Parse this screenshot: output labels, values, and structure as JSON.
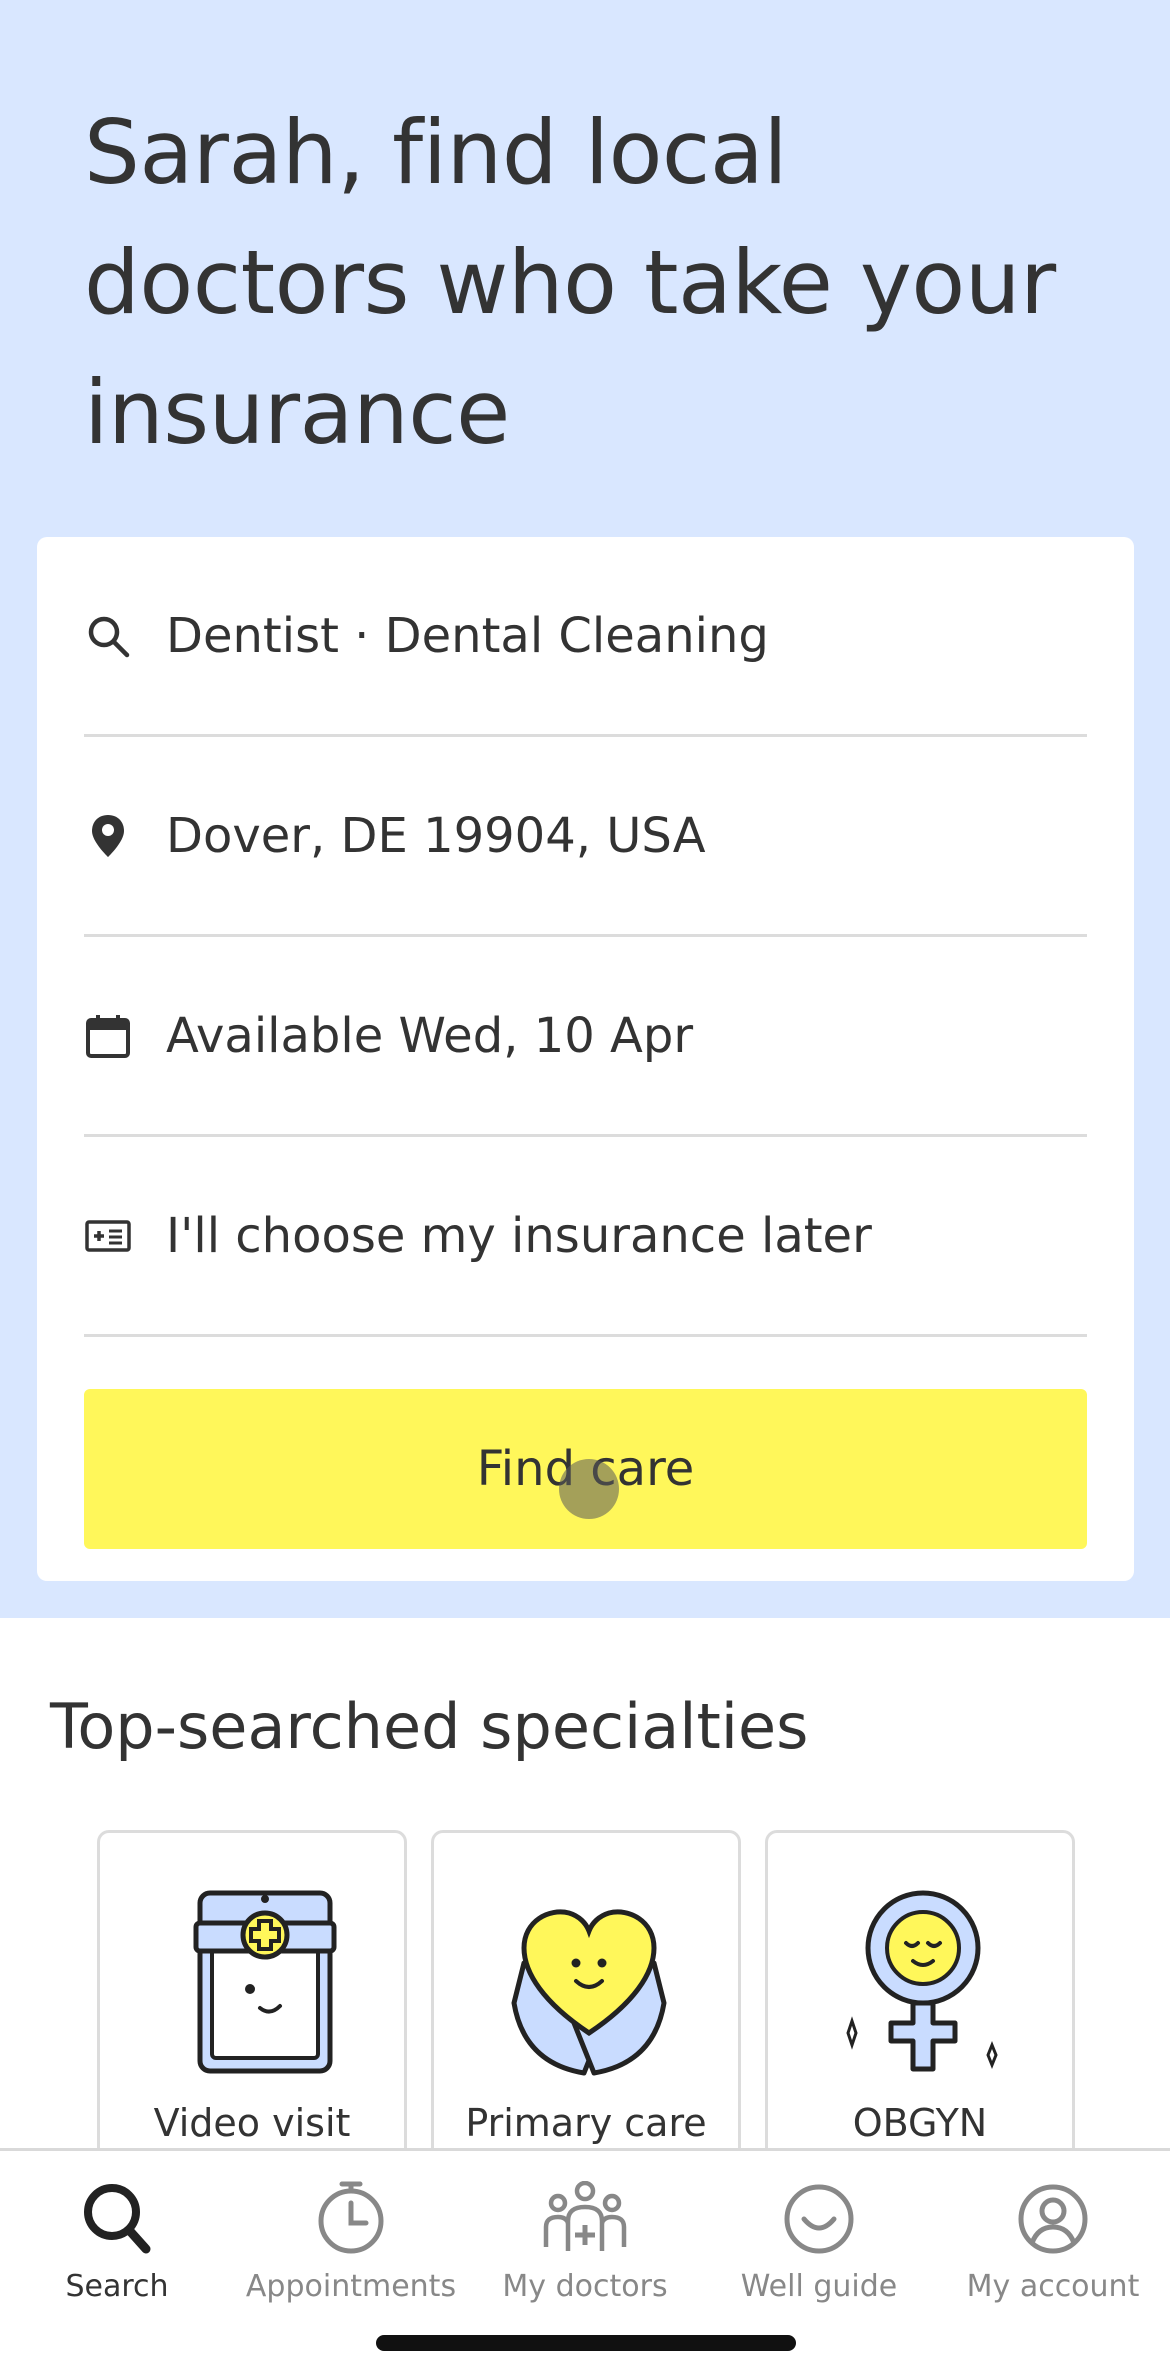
{
  "hero": {
    "headline": "Sarah, find local doctors who take your insurance"
  },
  "search_form": {
    "specialty": "Dentist · Dental Cleaning",
    "location": "Dover, DE 19904, USA",
    "availability": "Available Wed, 10 Apr",
    "insurance": "I'll choose my insurance later",
    "find_button": "Find care"
  },
  "specialties": {
    "title": "Top-searched specialties",
    "items": [
      {
        "label": "Video visit",
        "icon": "video-visit-icon"
      },
      {
        "label": "Primary care",
        "icon": "primary-care-icon"
      },
      {
        "label": "OBGYN",
        "icon": "obgyn-icon"
      }
    ]
  },
  "nav": {
    "items": [
      {
        "label": "Search",
        "icon": "search-icon",
        "active": true
      },
      {
        "label": "Appointments",
        "icon": "timer-icon",
        "active": false
      },
      {
        "label": "My doctors",
        "icon": "people-icon",
        "active": false
      },
      {
        "label": "Well guide",
        "icon": "smile-icon",
        "active": false
      },
      {
        "label": "My account",
        "icon": "account-icon",
        "active": false
      }
    ]
  },
  "colors": {
    "hero_bg": "#d9e7ff",
    "button_yellow": "#fff75a",
    "text_dark": "#333333",
    "divider": "#dcdcdc"
  }
}
